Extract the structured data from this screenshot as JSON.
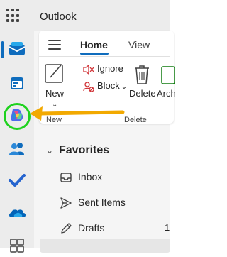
{
  "app": {
    "title": "Outlook"
  },
  "rail": {
    "items": [
      {
        "name": "mail",
        "icon": "mail-icon"
      },
      {
        "name": "calendar",
        "icon": "calendar-icon"
      },
      {
        "name": "copilot",
        "icon": "copilot-icon"
      },
      {
        "name": "people",
        "icon": "people-icon"
      },
      {
        "name": "todo",
        "icon": "todo-check-icon"
      },
      {
        "name": "onedrive",
        "icon": "onedrive-icon"
      },
      {
        "name": "more-apps",
        "icon": "apps-icon"
      }
    ],
    "accent": "#0f6cbd"
  },
  "tabs": [
    {
      "label": "Home",
      "active": true
    },
    {
      "label": "View",
      "active": false
    }
  ],
  "ribbon": {
    "new_label": "New",
    "new_group_label": "New",
    "ignore_label": "Ignore",
    "block_label": "Block",
    "delete_label": "Delete",
    "archive_label": "Arch",
    "delete_group_label": "Delete"
  },
  "folders": {
    "favorites_label": "Favorites",
    "items": [
      {
        "label": "Inbox",
        "icon": "inbox-icon",
        "count": ""
      },
      {
        "label": "Sent Items",
        "icon": "send-icon",
        "count": ""
      },
      {
        "label": "Drafts",
        "icon": "drafts-pencil-icon",
        "count": "1"
      }
    ]
  },
  "annotation": {
    "circle_color": "#1fd21f",
    "arrow_color": "#f2a900"
  }
}
